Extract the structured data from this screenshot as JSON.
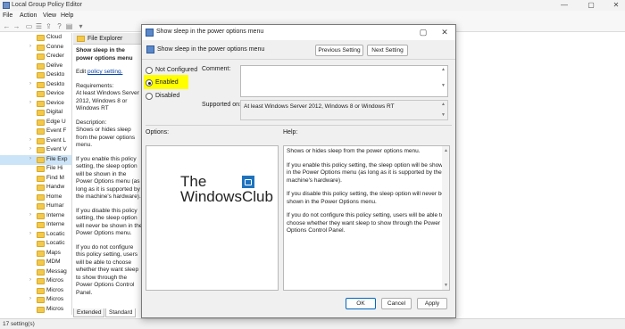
{
  "app": {
    "title": "Local Group Policy Editor",
    "menu": [
      "File",
      "Action",
      "View",
      "Help"
    ],
    "window_controls": [
      "—",
      "▢",
      "✕"
    ],
    "toolbar_icons": [
      "back-icon",
      "forward-icon",
      "folder-icon",
      "list-icon",
      "export-icon",
      "help-icon",
      "properties-icon",
      "filter-icon"
    ]
  },
  "tree": {
    "items": [
      {
        "label": "Cloud",
        "expandable": false
      },
      {
        "label": "Conne",
        "expandable": true
      },
      {
        "label": "Creder",
        "expandable": false
      },
      {
        "label": "Delive",
        "expandable": false
      },
      {
        "label": "Deskto",
        "expandable": false
      },
      {
        "label": "Deskto",
        "expandable": true
      },
      {
        "label": "Device",
        "expandable": false
      },
      {
        "label": "Device",
        "expandable": true
      },
      {
        "label": "Digital",
        "expandable": false
      },
      {
        "label": "Edge U",
        "expandable": false
      },
      {
        "label": "Event F",
        "expandable": false
      },
      {
        "label": "Event L",
        "expandable": true
      },
      {
        "label": "Event V",
        "expandable": true
      },
      {
        "label": "File Exp",
        "expandable": true,
        "selected": true
      },
      {
        "label": "File Hi",
        "expandable": false
      },
      {
        "label": "Find M",
        "expandable": false
      },
      {
        "label": "Handw",
        "expandable": false
      },
      {
        "label": "Home",
        "expandable": false
      },
      {
        "label": "Humar",
        "expandable": false
      },
      {
        "label": "Interne",
        "expandable": true
      },
      {
        "label": "Interne",
        "expandable": false
      },
      {
        "label": "Locatic",
        "expandable": true
      },
      {
        "label": "Locatic",
        "expandable": false
      },
      {
        "label": "Maps",
        "expandable": false
      },
      {
        "label": "MDM",
        "expandable": false
      },
      {
        "label": "Messag",
        "expandable": false
      },
      {
        "label": "Micros",
        "expandable": true
      },
      {
        "label": "Micros",
        "expandable": false
      },
      {
        "label": "Micros",
        "expandable": true
      },
      {
        "label": "Micros",
        "expandable": false
      }
    ]
  },
  "description": {
    "header": "File Explorer",
    "title": "Show sleep in the power options menu",
    "edit_prefix": "Edit",
    "edit_link": "policy setting.",
    "requirements_label": "Requirements:",
    "requirements_text": "At least Windows Server 2012, Windows 8 or Windows RT",
    "description_label": "Description:",
    "description_text": "Shows or hides sleep from the power options menu.",
    "p1": "If you enable this policy setting, the sleep option will be shown in the Power Options menu (as long as it is supported by the machine's hardware).",
    "p2": "If you disable this policy setting, the sleep option will never be shown in the Power Options menu.",
    "p3": "If you do not configure this policy setting, users will be able to choose whether they want sleep to show through the Power Options Control Panel."
  },
  "bottom_tabs": [
    "Extended",
    "Standard"
  ],
  "status": "17 setting(s)",
  "dialog": {
    "title": "Show sleep in the power options menu",
    "header": "Show sleep in the power options menu",
    "prev_button": "Previous Setting",
    "next_button": "Next Setting",
    "radio_not_configured": "Not Configured",
    "radio_enabled": "Enabled",
    "radio_disabled": "Disabled",
    "selected_radio": "Enabled",
    "comment_label": "Comment:",
    "supported_label": "Supported on:",
    "supported_value": "At least Windows Server 2012, Windows 8 or Windows RT",
    "options_label": "Options:",
    "help_label": "Help:",
    "help_p1": "Shows or hides sleep from the power options menu.",
    "help_p2": "If you enable this policy setting, the sleep option will be shown in the Power Options menu (as long as it is supported by the machine's hardware).",
    "help_p3": "If you disable this policy setting, the sleep option will never be shown in the Power Options menu.",
    "help_p4": "If you do not configure this policy setting, users will be able to choose whether they want sleep to show through the Power Options Control Panel.",
    "ok_button": "OK",
    "cancel_button": "Cancel",
    "apply_button": "Apply",
    "watermark_line1": "The",
    "watermark_line2": "WindowsClub",
    "highlight_color": "#ffff00",
    "primary_border_color": "#0067c0"
  }
}
